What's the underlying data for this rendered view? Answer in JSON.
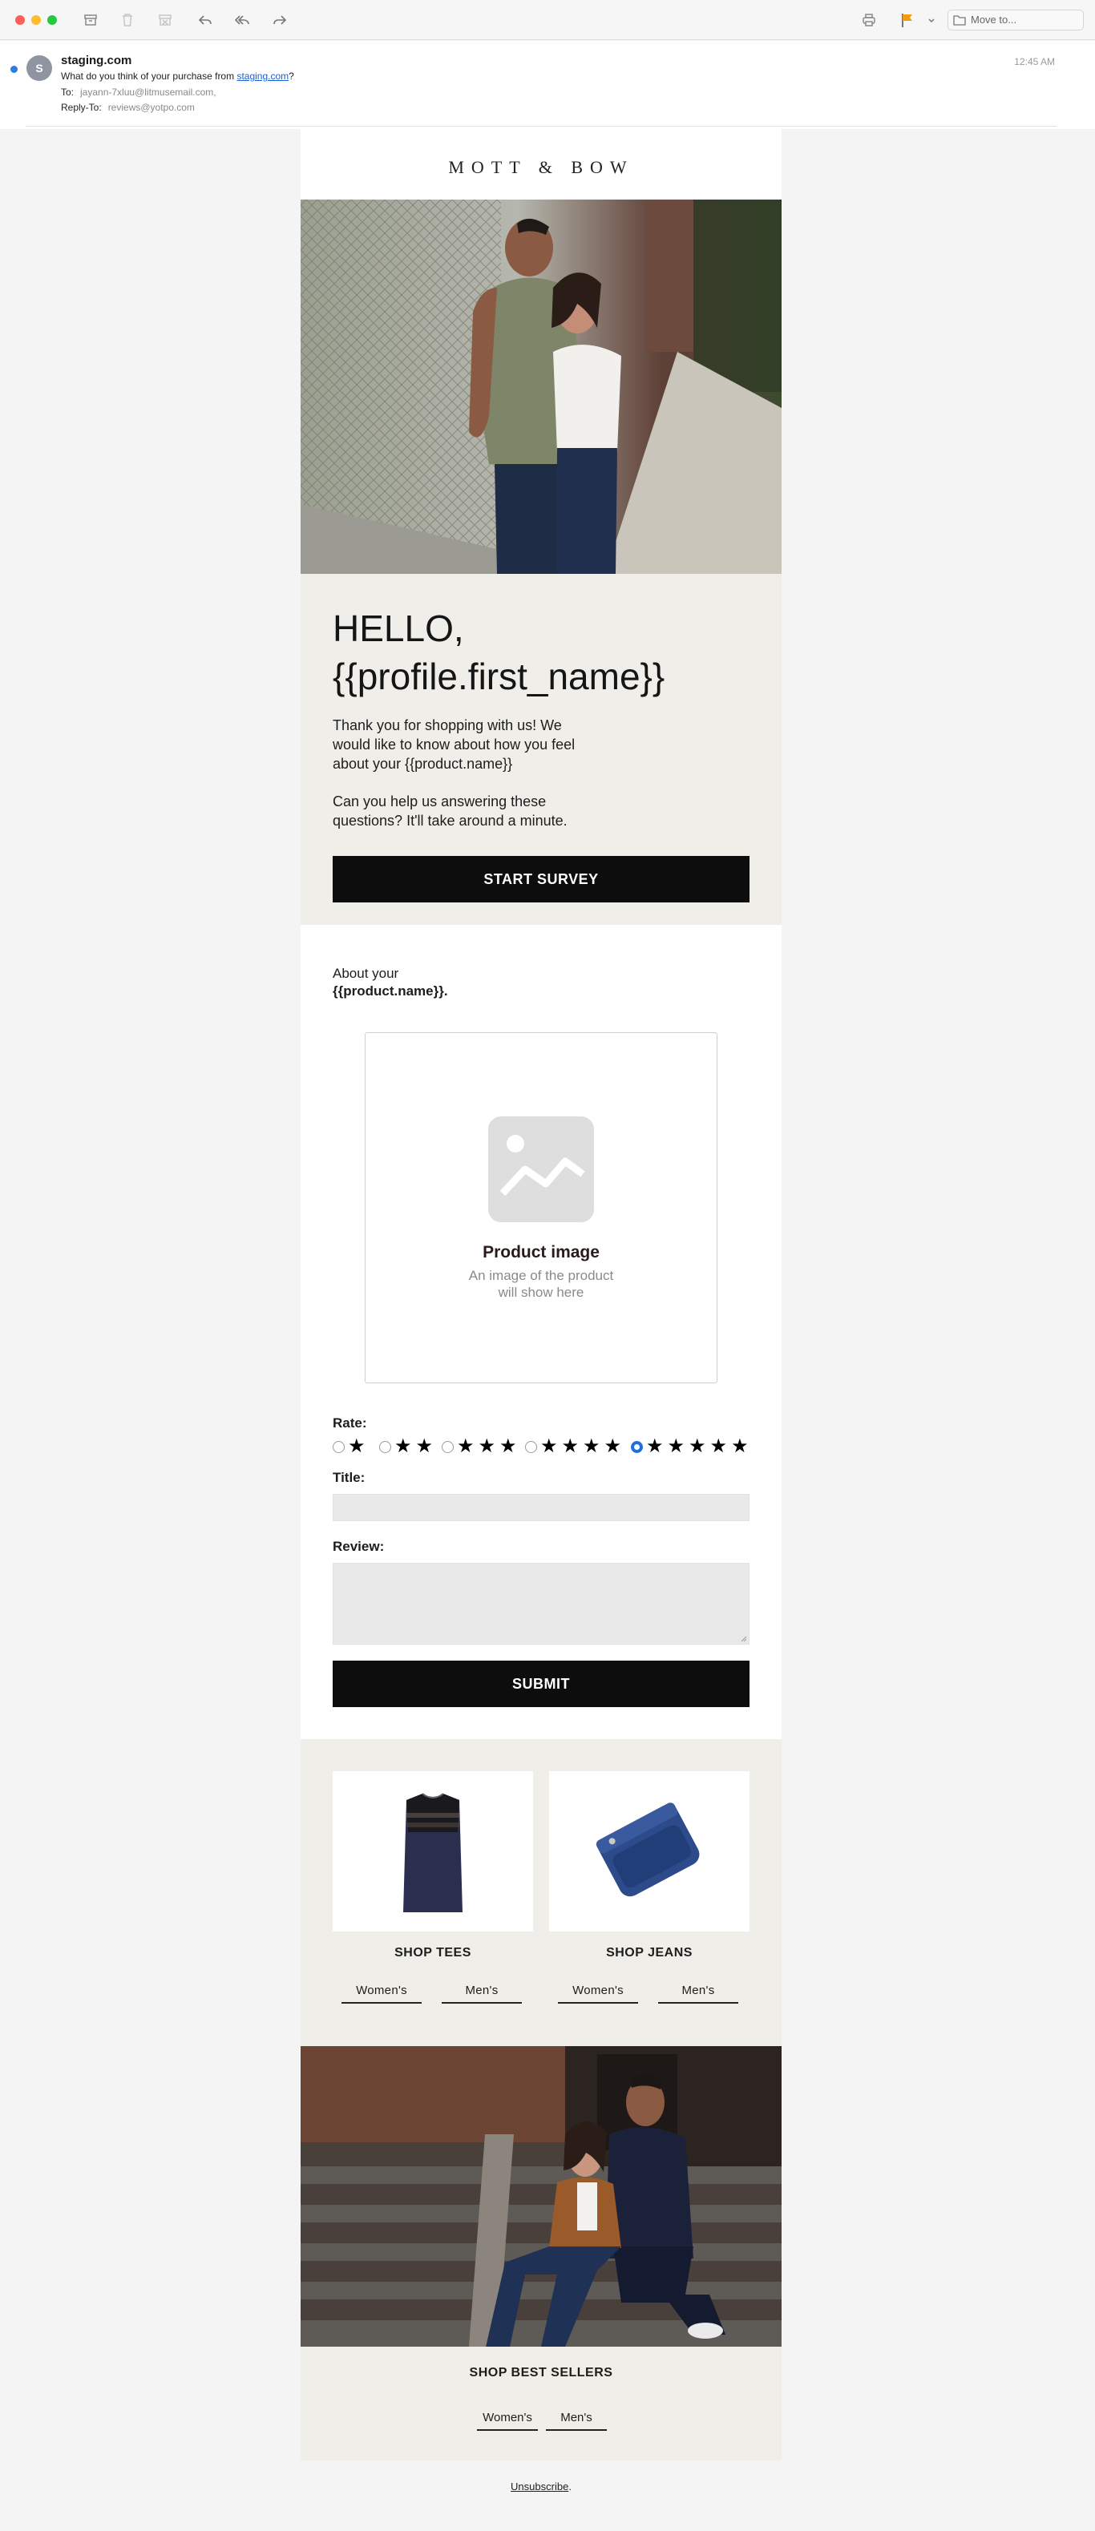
{
  "mail": {
    "toolbar": {
      "move_to_label": "Move to...",
      "flag_color": "#f39c12"
    },
    "message": {
      "avatar_initial": "S",
      "sender": "staging.com",
      "subject_prefix": "What do you think of your purchase from ",
      "subject_link": "staging.com",
      "subject_suffix": "?",
      "to_label": "To:",
      "to_value": "jayann-7xluu@litmusemail.com,",
      "reply_label": "Reply-To:",
      "reply_value": "reviews@yotpo.com",
      "time": "12:45 AM"
    }
  },
  "email": {
    "logo": "MOTT & BOW",
    "hello_line1": "HELLO,",
    "hello_line2": "{{profile.first_name}}",
    "intro": "Thank you for shopping with us! We would like to know about how you feel about your {{product.name}}",
    "intro2": "Can you help us answering these questions? It'll take around a minute.",
    "start_button": "START SURVEY",
    "about_prefix": "About your",
    "about_product": "{{product.name}}.",
    "product_placeholder_title": "Product image",
    "product_placeholder_sub": "An image of the product will show here",
    "rate_label": "Rate:",
    "rating_options": [
      1,
      2,
      3,
      4,
      5
    ],
    "rating_selected": 5,
    "title_label": "Title:",
    "review_label": "Review:",
    "submit_button": "SUBMIT",
    "shop_tees": "SHOP TEES",
    "shop_jeans": "SHOP JEANS",
    "womens": "Women's",
    "mens": "Men's",
    "best_sellers": "SHOP BEST SELLERS",
    "unsubscribe": "Unsubscribe",
    "unsubscribe_suffix": ".",
    "accent_black": "#0d0d0d",
    "section_beige": "#f0eee8"
  }
}
